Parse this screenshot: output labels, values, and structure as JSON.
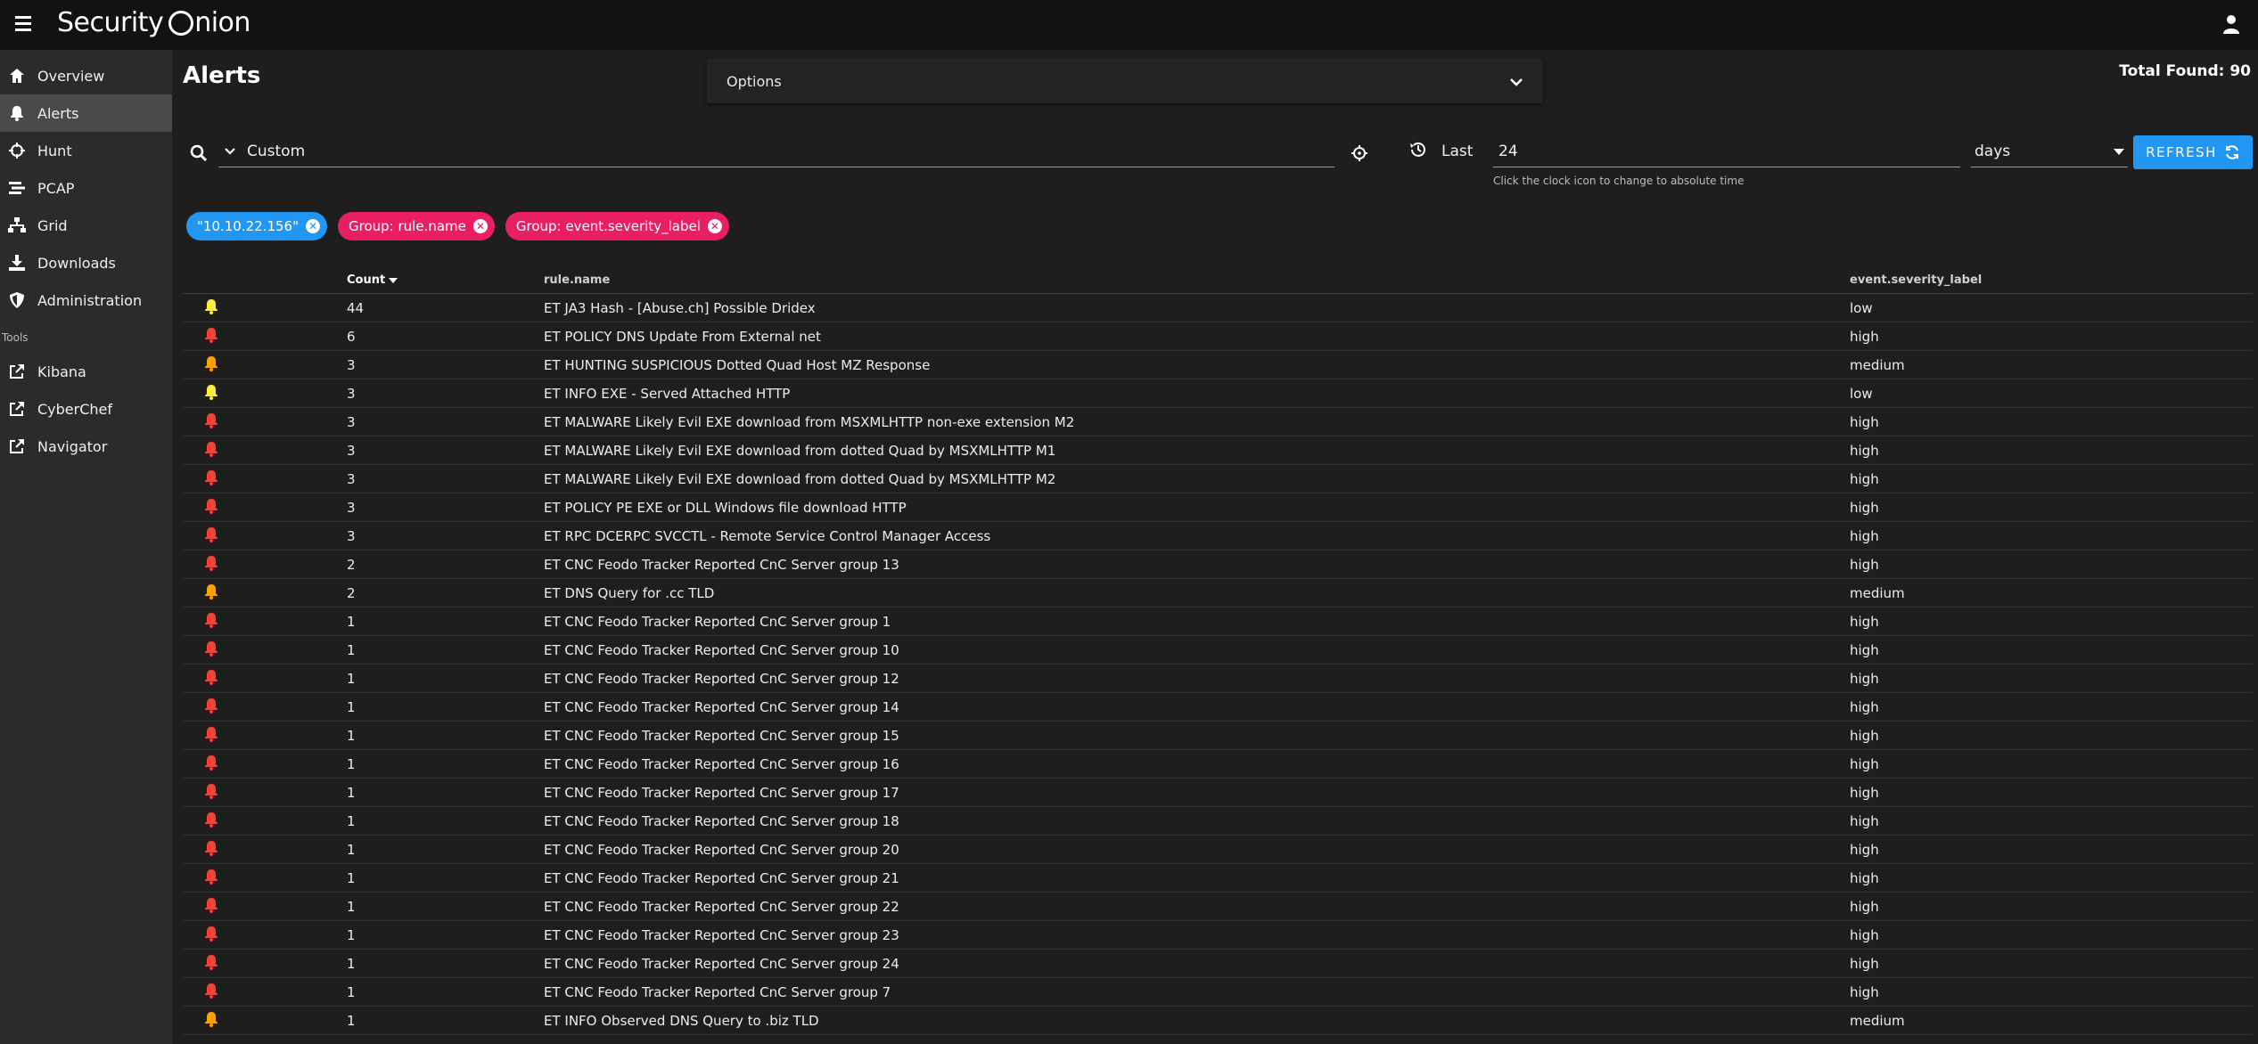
{
  "app": {
    "brand_prefix": "Security",
    "brand_suffix": "nion"
  },
  "sidebar": {
    "items": [
      {
        "label": "Overview",
        "icon": "home-icon"
      },
      {
        "label": "Alerts",
        "icon": "bell-icon"
      },
      {
        "label": "Hunt",
        "icon": "crosshairs-icon"
      },
      {
        "label": "PCAP",
        "icon": "stream-icon"
      },
      {
        "label": "Grid",
        "icon": "sitemap-icon"
      },
      {
        "label": "Downloads",
        "icon": "download-icon"
      },
      {
        "label": "Administration",
        "icon": "shield-icon"
      }
    ],
    "tools_label": "Tools",
    "tools": [
      {
        "label": "Kibana",
        "icon": "external-link-icon"
      },
      {
        "label": "CyberChef",
        "icon": "external-link-icon"
      },
      {
        "label": "Navigator",
        "icon": "external-link-icon"
      }
    ]
  },
  "main": {
    "title": "Alerts",
    "options_label": "Options",
    "total_found": "Total Found: 90",
    "query": {
      "value": "Custom"
    },
    "time": {
      "last_label": "Last",
      "last_value": "24",
      "hint": "Click the clock icon to change to absolute time",
      "unit": "days"
    },
    "refresh_label": "REFRESH",
    "chips": [
      {
        "label": "\"10.10.22.156\"",
        "color": "blue"
      },
      {
        "label": "Group: rule.name",
        "color": "pink"
      },
      {
        "label": "Group: event.severity_label",
        "color": "pink"
      }
    ],
    "table": {
      "headers": [
        "Count",
        "rule.name",
        "event.severity_label"
      ],
      "rows": [
        {
          "count": "44",
          "rule": "ET JA3 Hash - [Abuse.ch] Possible Dridex",
          "sev": "low"
        },
        {
          "count": "6",
          "rule": "ET POLICY DNS Update From External net",
          "sev": "high"
        },
        {
          "count": "3",
          "rule": "ET HUNTING SUSPICIOUS Dotted Quad Host MZ Response",
          "sev": "medium"
        },
        {
          "count": "3",
          "rule": "ET INFO EXE - Served Attached HTTP",
          "sev": "low"
        },
        {
          "count": "3",
          "rule": "ET MALWARE Likely Evil EXE download from MSXMLHTTP non-exe extension M2",
          "sev": "high"
        },
        {
          "count": "3",
          "rule": "ET MALWARE Likely Evil EXE download from dotted Quad by MSXMLHTTP M1",
          "sev": "high"
        },
        {
          "count": "3",
          "rule": "ET MALWARE Likely Evil EXE download from dotted Quad by MSXMLHTTP M2",
          "sev": "high"
        },
        {
          "count": "3",
          "rule": "ET POLICY PE EXE or DLL Windows file download HTTP",
          "sev": "high"
        },
        {
          "count": "3",
          "rule": "ET RPC DCERPC SVCCTL - Remote Service Control Manager Access",
          "sev": "high"
        },
        {
          "count": "2",
          "rule": "ET CNC Feodo Tracker Reported CnC Server group 13",
          "sev": "high"
        },
        {
          "count": "2",
          "rule": "ET DNS Query for .cc TLD",
          "sev": "medium"
        },
        {
          "count": "1",
          "rule": "ET CNC Feodo Tracker Reported CnC Server group 1",
          "sev": "high"
        },
        {
          "count": "1",
          "rule": "ET CNC Feodo Tracker Reported CnC Server group 10",
          "sev": "high"
        },
        {
          "count": "1",
          "rule": "ET CNC Feodo Tracker Reported CnC Server group 12",
          "sev": "high"
        },
        {
          "count": "1",
          "rule": "ET CNC Feodo Tracker Reported CnC Server group 14",
          "sev": "high"
        },
        {
          "count": "1",
          "rule": "ET CNC Feodo Tracker Reported CnC Server group 15",
          "sev": "high"
        },
        {
          "count": "1",
          "rule": "ET CNC Feodo Tracker Reported CnC Server group 16",
          "sev": "high"
        },
        {
          "count": "1",
          "rule": "ET CNC Feodo Tracker Reported CnC Server group 17",
          "sev": "high"
        },
        {
          "count": "1",
          "rule": "ET CNC Feodo Tracker Reported CnC Server group 18",
          "sev": "high"
        },
        {
          "count": "1",
          "rule": "ET CNC Feodo Tracker Reported CnC Server group 20",
          "sev": "high"
        },
        {
          "count": "1",
          "rule": "ET CNC Feodo Tracker Reported CnC Server group 21",
          "sev": "high"
        },
        {
          "count": "1",
          "rule": "ET CNC Feodo Tracker Reported CnC Server group 22",
          "sev": "high"
        },
        {
          "count": "1",
          "rule": "ET CNC Feodo Tracker Reported CnC Server group 23",
          "sev": "high"
        },
        {
          "count": "1",
          "rule": "ET CNC Feodo Tracker Reported CnC Server group 24",
          "sev": "high"
        },
        {
          "count": "1",
          "rule": "ET CNC Feodo Tracker Reported CnC Server group 7",
          "sev": "high"
        },
        {
          "count": "1",
          "rule": "ET INFO Observed DNS Query to .biz TLD",
          "sev": "medium"
        }
      ]
    }
  },
  "colors": {
    "high": "#f44336",
    "medium": "#ffa000",
    "low": "#ffeb3b",
    "accent_blue": "#2196f3",
    "accent_pink": "#e91e63"
  }
}
